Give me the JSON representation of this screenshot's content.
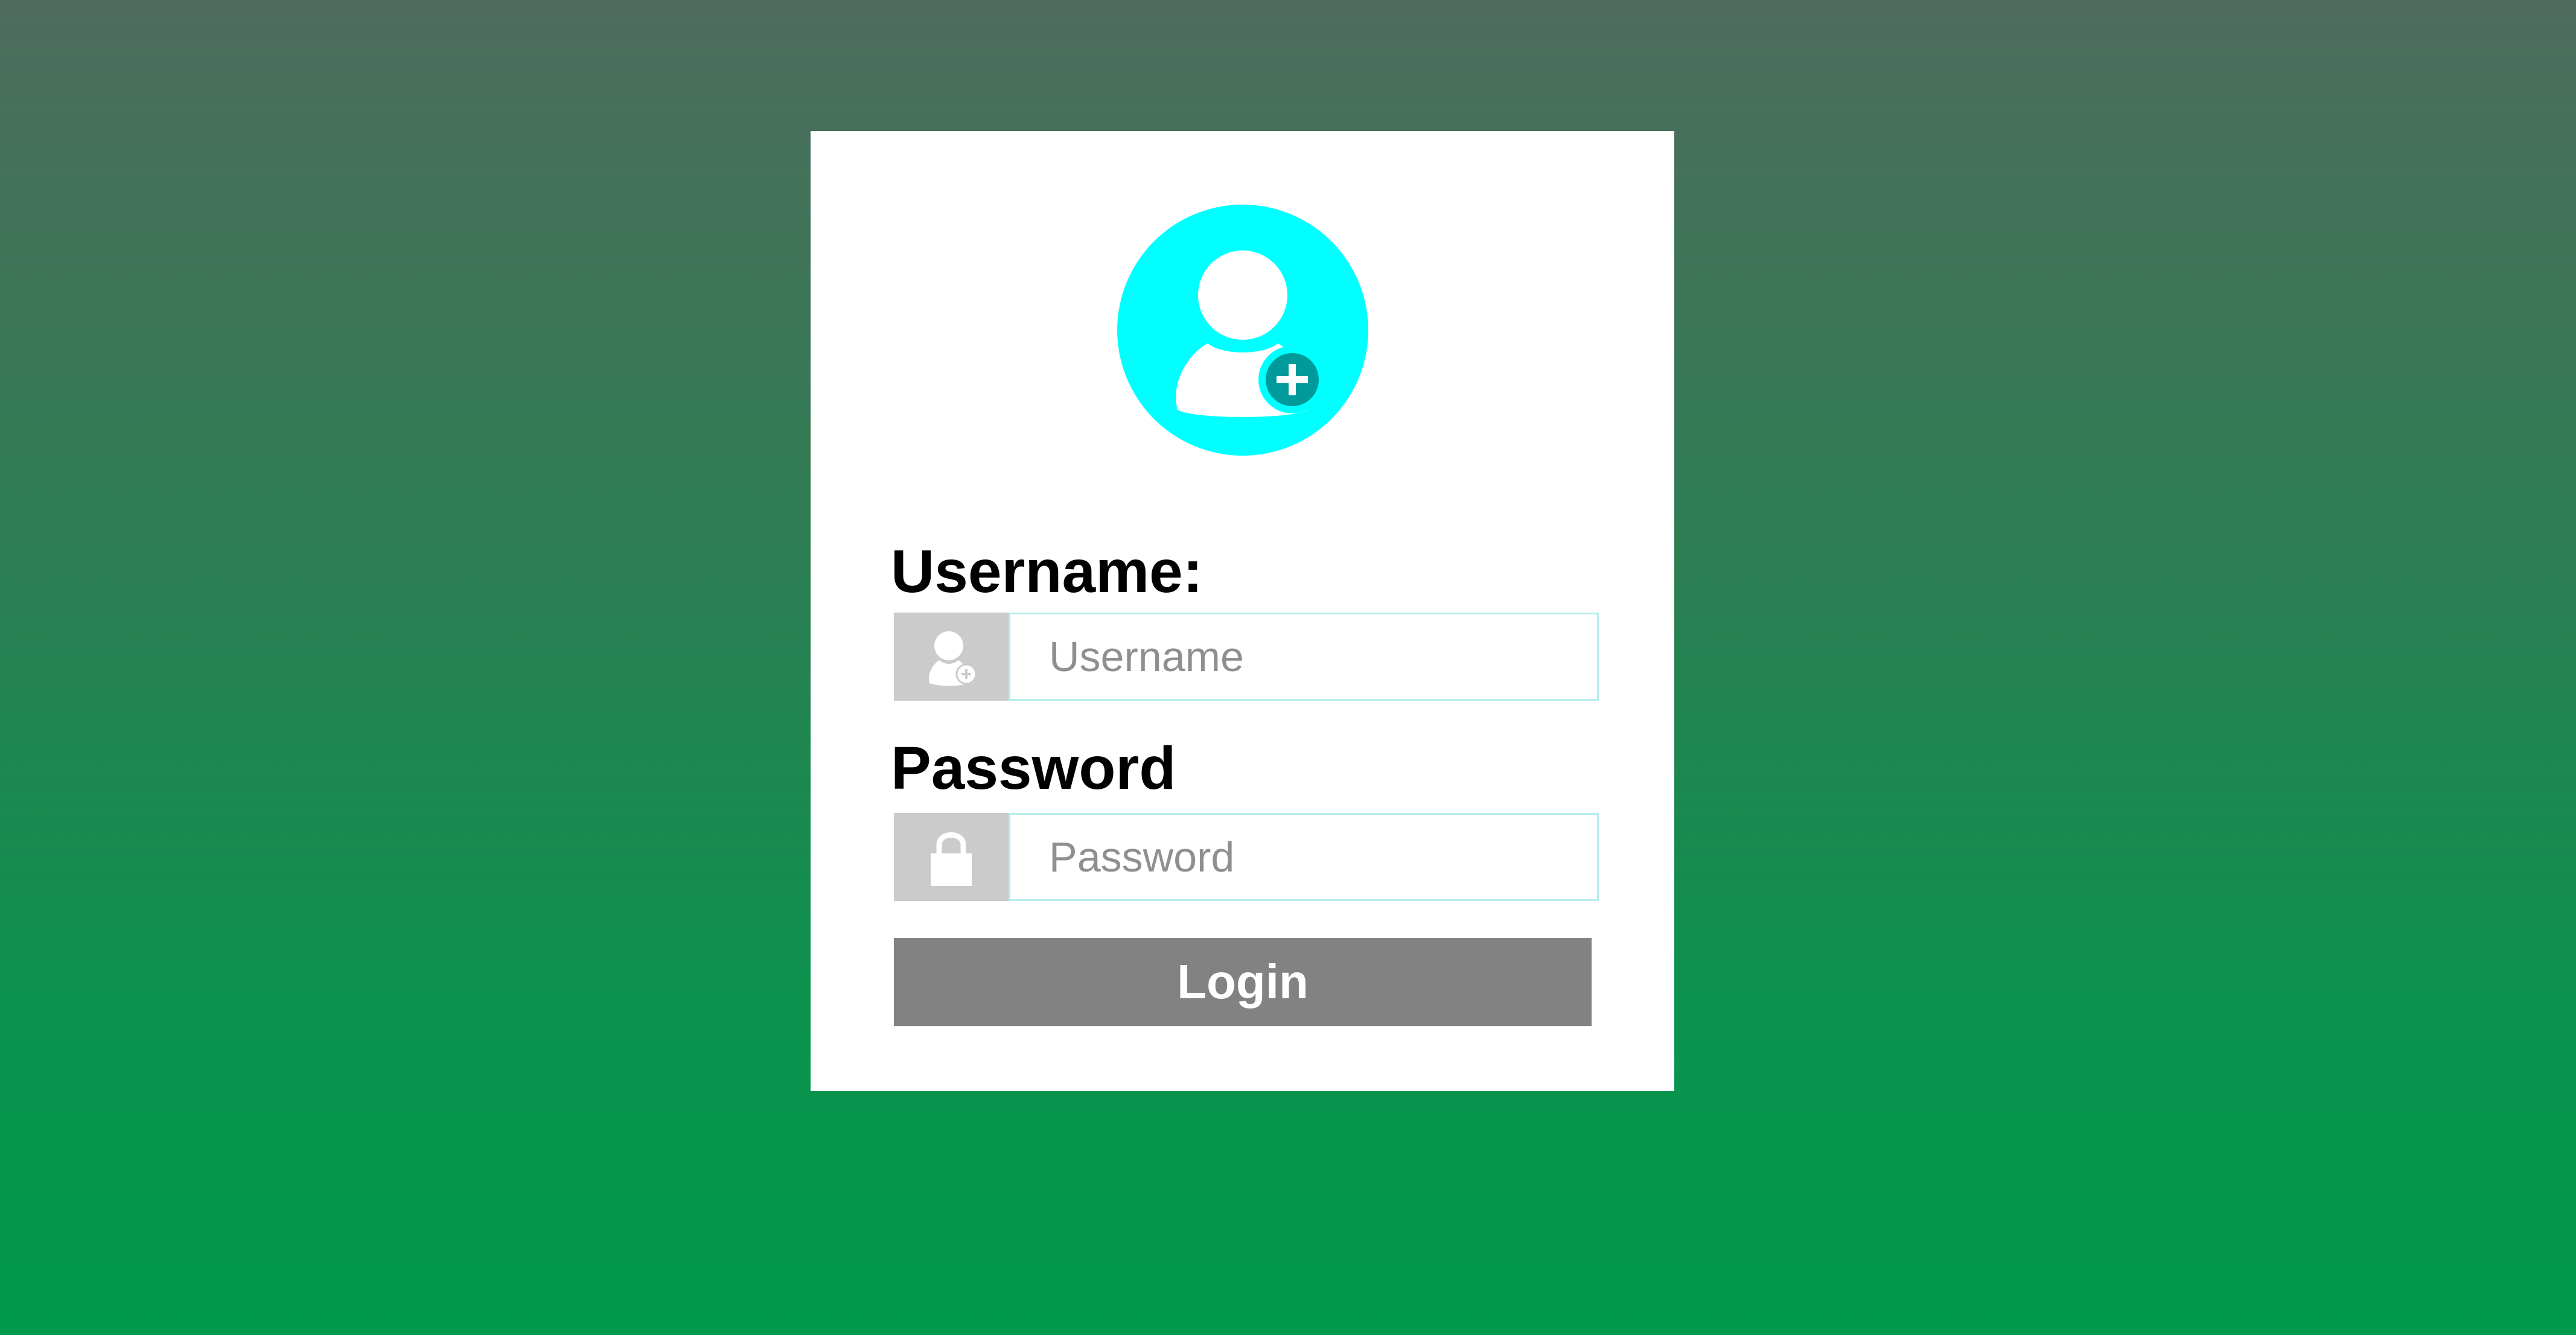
{
  "colors": {
    "accent_avatar": "#00ffff",
    "card_background": "#ffffff",
    "icon_box": "#cbcbcb",
    "input_border": "#b5ebef",
    "login_button": "#828282",
    "background_top": "#4e6c5e",
    "background_bottom": "#009a4c"
  },
  "header": {
    "avatar_icon": "user-add-icon"
  },
  "form": {
    "username": {
      "label": "Username:",
      "placeholder": "Username",
      "value": "",
      "icon": "user-add-icon"
    },
    "password": {
      "label": "Password",
      "placeholder": "Password",
      "value": "",
      "icon": "lock-icon"
    },
    "login_label": "Login"
  }
}
